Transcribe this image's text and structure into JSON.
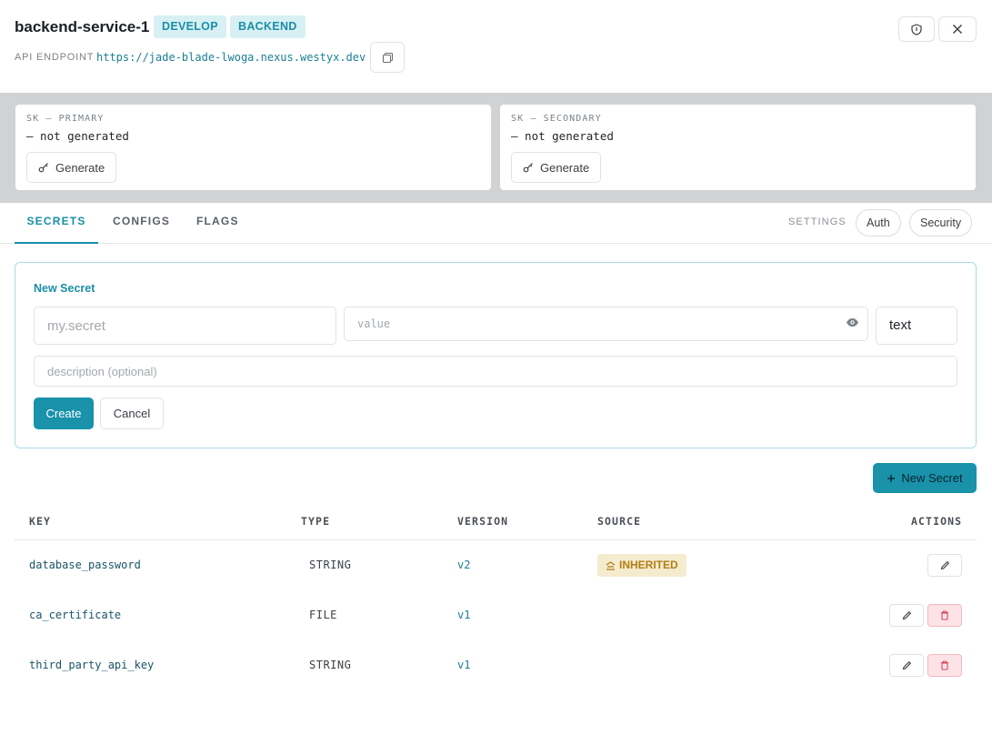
{
  "header": {
    "title": "backend-service-1",
    "tags": [
      "DEVELOP",
      "BACKEND"
    ],
    "endpoint_label": "API ENDPOINT",
    "endpoint_url": "https://jade-blade-lwoga.nexus.westyx.dev"
  },
  "keys": {
    "primary": {
      "label": "SK — PRIMARY",
      "value": "— not generated",
      "button": "Generate"
    },
    "secondary": {
      "label": "SK — SECONDARY",
      "value": "— not generated",
      "button": "Generate"
    }
  },
  "tabs": {
    "items": [
      "SECRETS",
      "CONFIGS",
      "FLAGS"
    ],
    "active": "SECRETS",
    "settings_label": "SETTINGS",
    "settings_items": [
      "Auth",
      "Security"
    ]
  },
  "form": {
    "title": "New Secret",
    "key_placeholder": "my.secret",
    "value_placeholder": "value",
    "type_value": "text",
    "description_placeholder": "description (optional)",
    "create_label": "Create",
    "cancel_label": "Cancel"
  },
  "new_secret_button": "New Secret",
  "table": {
    "columns": [
      "KEY",
      "TYPE",
      "VERSION",
      "SOURCE",
      "ACTIONS"
    ],
    "rows": [
      {
        "key": "database_password",
        "type": "STRING",
        "version": "v2",
        "source": "INHERITED"
      },
      {
        "key": "ca_certificate",
        "type": "FILE",
        "version": "v1",
        "source": ""
      },
      {
        "key": "third_party_api_key",
        "type": "STRING",
        "version": "v1",
        "source": ""
      }
    ]
  },
  "colors": {
    "accent": "#1992aa",
    "tag_bg": "#d7f0f4",
    "inherited_bg": "#f5ebcf",
    "inherited_fg": "#b07f14",
    "danger_bg": "#fde3e6"
  },
  "icons": [
    "shield-icon",
    "close-icon",
    "copy-icon",
    "key-icon",
    "eye-icon",
    "plus-icon",
    "inherited-icon",
    "edit-icon",
    "trash-icon"
  ]
}
